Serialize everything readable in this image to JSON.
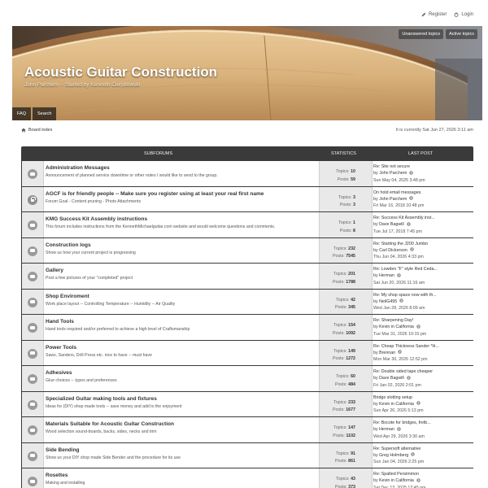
{
  "userbar": {
    "register": "Register",
    "login": "Login"
  },
  "header": {
    "title": "Acoustic Guitar Construction",
    "description": "John Parchem -- Started by Kenneth Cierpilowski",
    "unanswered": "Unanswered topics",
    "active": "Active topics",
    "faq": "FAQ",
    "search": "Search"
  },
  "breadcrumb": {
    "board_index": "Board index",
    "current_time": "It is currently Sat Jun 27, 2026 3:11 am"
  },
  "table": {
    "col_subforums": "SUBFORUMS",
    "col_statistics": "STATISTICS",
    "col_last_post": "LAST POST",
    "topics_label": "Topics:",
    "posts_label": "Posts:",
    "by_label": "by"
  },
  "forums": [
    {
      "title": "Administration Messages",
      "desc": "Announcement of planned service downtime or other notes I would like to send to the group.",
      "topics": "10",
      "posts": "59",
      "last_title": "Re: Site not secure",
      "last_user": "John Parchem",
      "last_date": "Sun May 04, 2025 3:48 pm",
      "locked": false
    },
    {
      "title": "AGCF is for friendly people -- Make sure you register using at least your real first name",
      "desc": "Forum Goal - Content pruning - Photo Attachments",
      "topics": "3",
      "posts": "3",
      "last_title": "On hold email messages.",
      "last_user": "John Parchem",
      "last_date": "Fri Mar 16, 2018 10:48 pm",
      "locked": true
    },
    {
      "title": "KMG Success Kit Assembly instructions",
      "desc": "This forum includes instructions from the KennethMichaelguitar.com website and would welcome questions and comments.",
      "topics": "1",
      "posts": "8",
      "last_title": "Re: Success Kit Assembly inst...",
      "last_user": "Dave Bagwill",
      "last_date": "Tue Jul 17, 2018 7:45 pm",
      "locked": false
    },
    {
      "title": "Construction logs",
      "desc": "Show us how your current project is progressing",
      "topics": "232",
      "posts": "7545",
      "last_title": "Re: Starting the J200 Jumbo",
      "last_user": "Carl Dickerson",
      "last_date": "Thu Jun 04, 2026 4:33 pm",
      "locked": false
    },
    {
      "title": "Gallery",
      "desc": "Post a few pictures of your \"completed\" project",
      "topics": "201",
      "posts": "1788",
      "last_title": "Re: Lowden \"F\" style Red Ceda...",
      "last_user": "Herman",
      "last_date": "Sat Jun 20, 2026 11:16 am",
      "locked": false
    },
    {
      "title": "Shop Enviroment",
      "desc": "Work place layout -- Controlling Temperature -- Humidity -- Air Quality",
      "topics": "42",
      "posts": "345",
      "last_title": "Re: My shop space now with th...",
      "last_user": "NeilG495",
      "last_date": "Wed Jan 28, 2026 8:09 am",
      "locked": false
    },
    {
      "title": "Hand Tools",
      "desc": "Hand tools required and/or preferred to achieve a high level of Craftsmanship",
      "topics": "154",
      "posts": "1092",
      "last_title": "Re: Sharpening Day!",
      "last_user": "Kevin in California",
      "last_date": "Tue Mar 31, 2026 10:15 pm",
      "locked": false
    },
    {
      "title": "Power Tools",
      "desc": "Saws, Sanders, Drill Press etc. nice to have -- must have",
      "topics": "149",
      "posts": "1272",
      "last_title": "Re: Cheap Thickness Sander *H...",
      "last_user": "Brennan",
      "last_date": "Mon Mar 30, 2026 12:52 pm",
      "locked": false
    },
    {
      "title": "Adhesives",
      "desc": "Glue choices -- types and preferences",
      "topics": "60",
      "posts": "484",
      "last_title": "Re: Double sided tape cheaper",
      "last_user": "Dave Bagwill",
      "last_date": "Fri Jan 02, 2026 2:01 pm",
      "locked": false
    },
    {
      "title": "Specialized Guitar making tools and fixtures",
      "desc": "Ideas for (DIY) shop made tools -- save money and add to the enjoyment",
      "topics": "233",
      "posts": "1677",
      "last_title": "Bridge slotting setup",
      "last_user": "Kevin in California",
      "last_date": "Sun Apr 26, 2026 5:13 pm",
      "locked": false
    },
    {
      "title": "Materials Suitable for Acoustic Guitar Construction",
      "desc": "Wood selection sound-boards, backs, sides, necks and trim",
      "topics": "147",
      "posts": "1102",
      "last_title": "Re: Bocote for bridges, fretb...",
      "last_user": "Herman",
      "last_date": "Wed Apr 29, 2026 3:30 am",
      "locked": false
    },
    {
      "title": "Side Bending",
      "desc": "Show us your DIY shop made Side Bender and the procedure for its use",
      "topics": "91",
      "posts": "861",
      "last_title": "Re: Supersoft alternative",
      "last_user": "Greg Holmberg",
      "last_date": "Sun Jan 04, 2026 2:25 pm",
      "locked": false
    },
    {
      "title": "Rosettes",
      "desc": "Making and installing",
      "topics": "43",
      "posts": "373",
      "last_title": "Re: Spalted Persimmon",
      "last_user": "Kevin in California",
      "last_date": "Sat Dec 13, 2025 12:45 pm",
      "locked": false
    }
  ]
}
